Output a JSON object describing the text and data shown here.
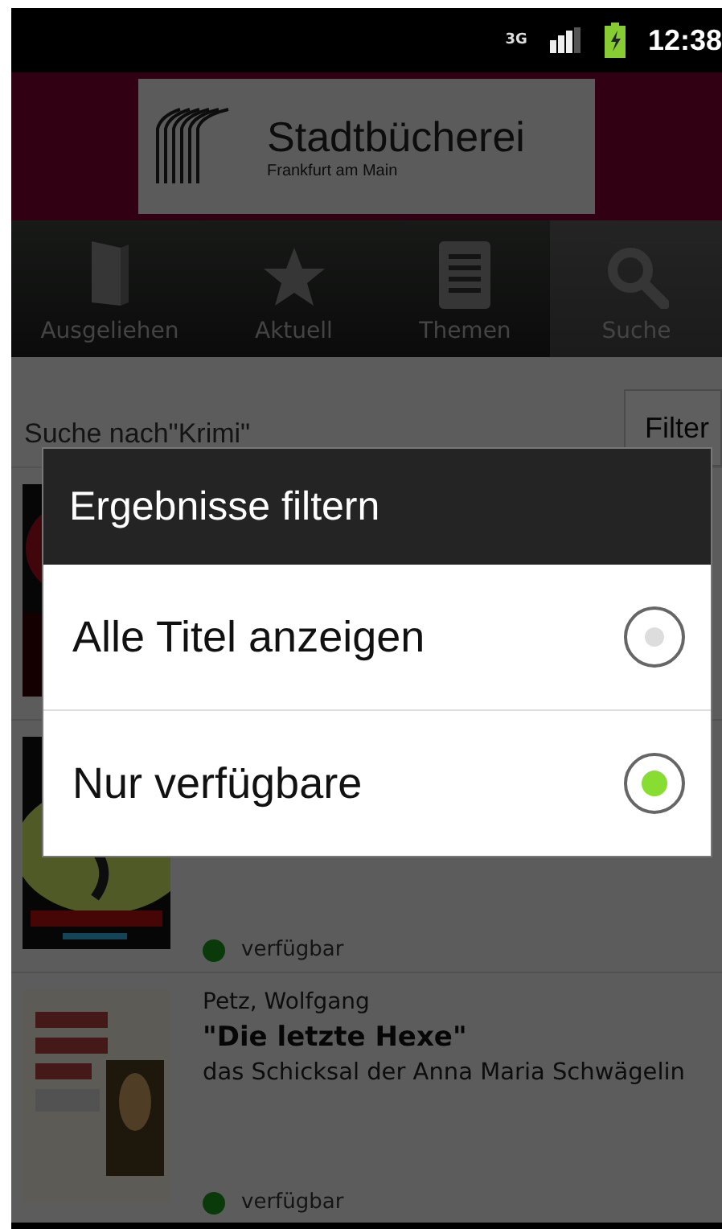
{
  "status_bar": {
    "time": "12:38",
    "network": "3G"
  },
  "header": {
    "logo_title": "Stadtbücherei",
    "logo_subtitle": "Frankfurt am Main"
  },
  "tabs": [
    {
      "label": "Ausgeliehen",
      "selected": false
    },
    {
      "label": "Aktuell",
      "selected": false
    },
    {
      "label": "Themen",
      "selected": false
    },
    {
      "label": "Suche",
      "selected": true
    }
  ],
  "search": {
    "query": "Suche nach\"Krimi\"",
    "filter_button": "Filter"
  },
  "results": [
    {
      "cover": true
    },
    {
      "cover": true,
      "available": true,
      "status": "verfügbar"
    },
    {
      "cover": true,
      "author": "Petz, Wolfgang",
      "title": "\"Die letzte Hexe\"",
      "subtitle": "das Schicksal der Anna Maria Schwägelin",
      "available": true,
      "status": "verfügbar"
    }
  ],
  "dialog": {
    "title": "Ergebnisse filtern",
    "options": [
      {
        "label": "Alle Titel anzeigen",
        "selected": false
      },
      {
        "label": "Nur verfügbare",
        "selected": true
      }
    ]
  }
}
